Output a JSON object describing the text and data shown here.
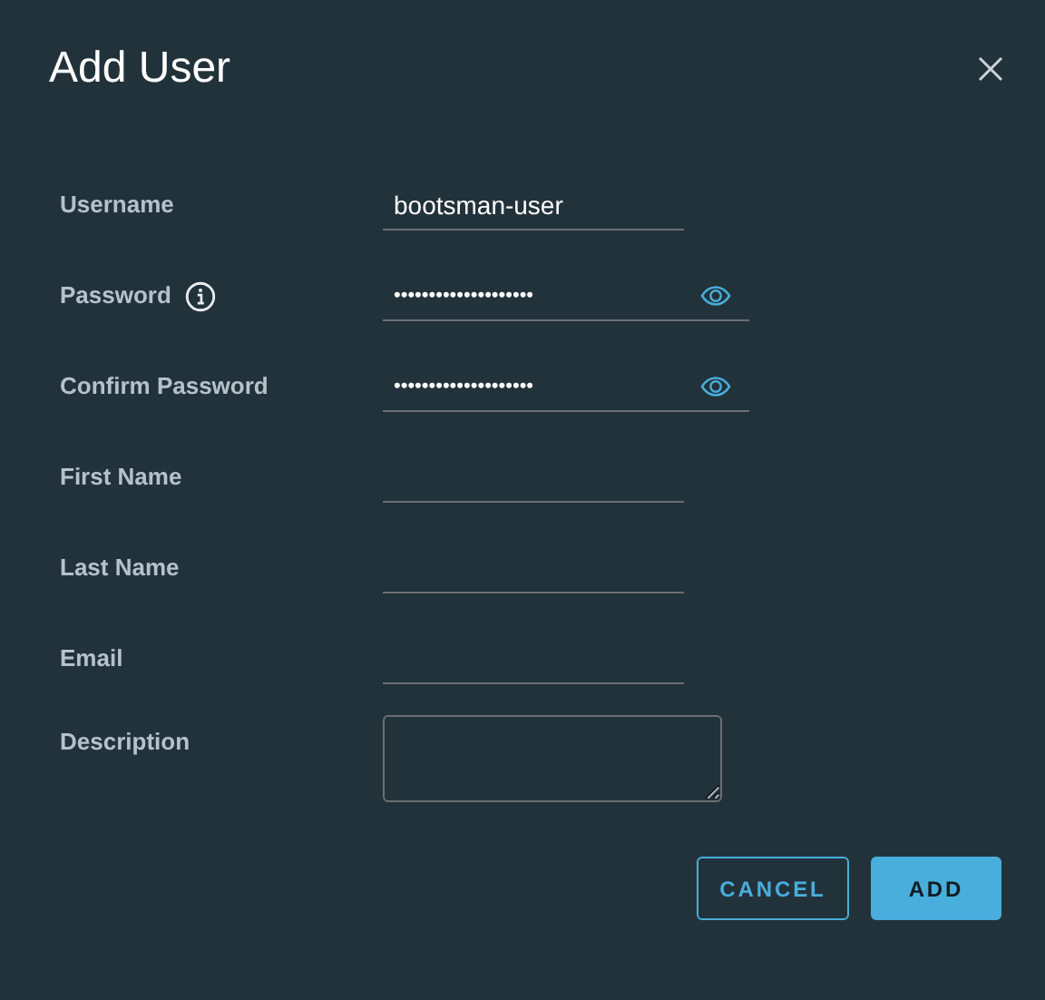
{
  "dialog": {
    "title": "Add User"
  },
  "fields": [
    {
      "kind": "text",
      "label": "Username",
      "value": "bootsman-user"
    },
    {
      "kind": "password",
      "label": "Password",
      "value": "••••••••••••••••••••",
      "info": true
    },
    {
      "kind": "password",
      "label": "Confirm Password",
      "value": "••••••••••••••••••••",
      "info": false
    },
    {
      "kind": "text",
      "label": "First Name"
    },
    {
      "kind": "text",
      "label": "Last Name"
    },
    {
      "kind": "text",
      "label": "Email"
    },
    {
      "kind": "textarea",
      "label": "Description"
    }
  ],
  "buttons": [
    {
      "label": "CANCEL",
      "kind": "outline"
    },
    {
      "label": "ADD",
      "kind": "primary"
    }
  ]
}
